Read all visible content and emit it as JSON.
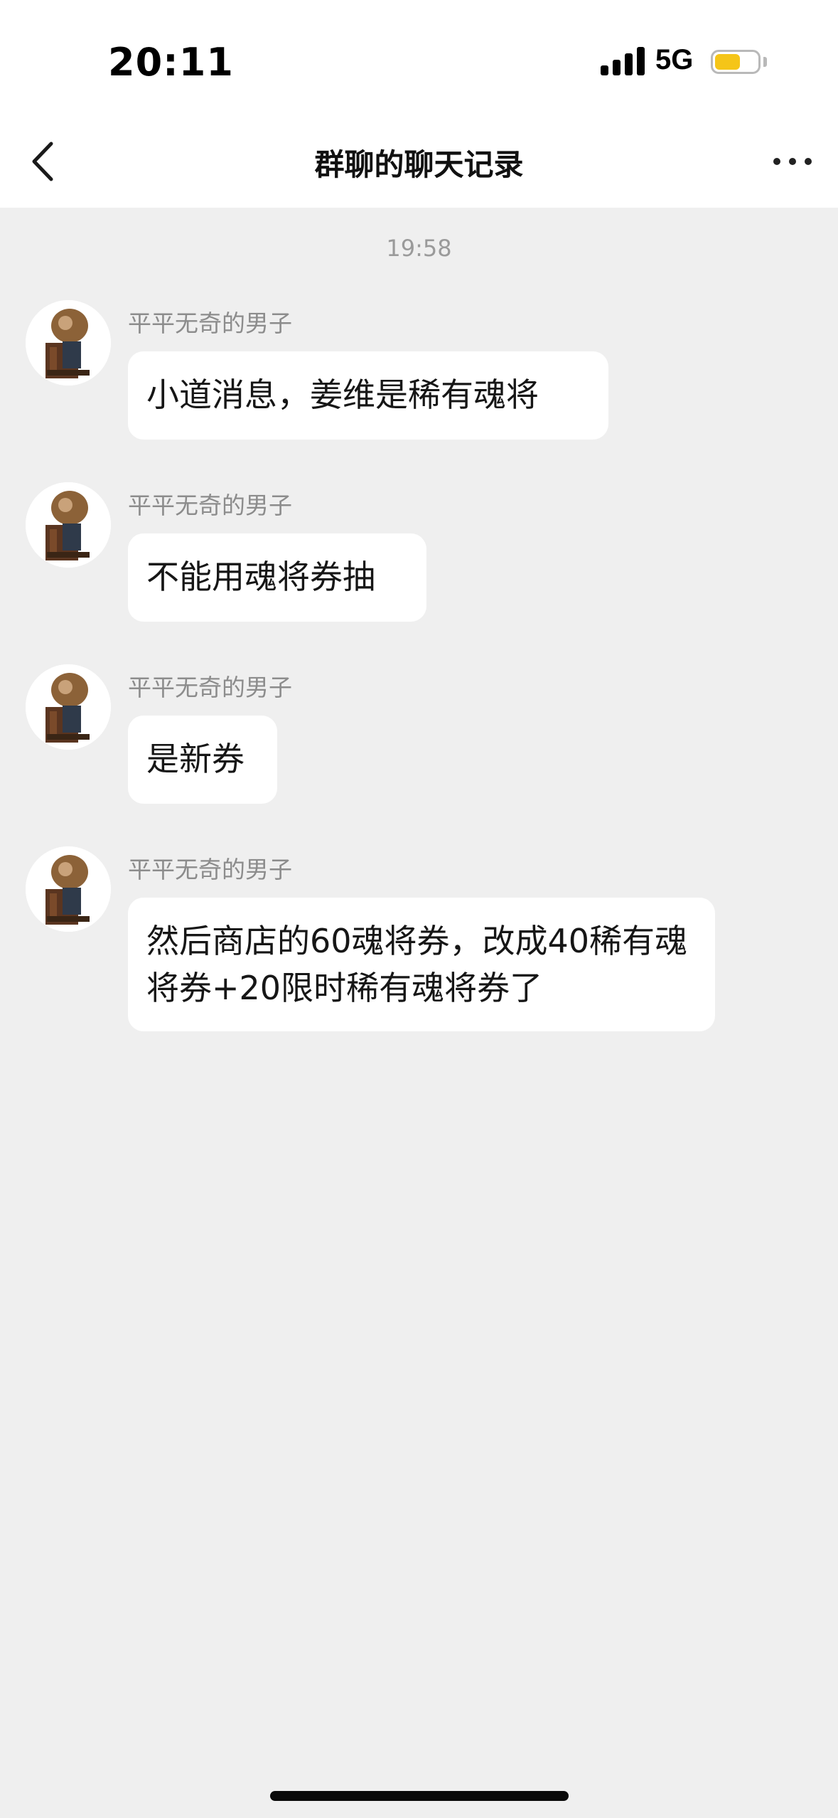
{
  "status_bar": {
    "time": "20:11",
    "network": "5G",
    "battery_color": "#f5c518",
    "battery_level": 0.6
  },
  "nav": {
    "title": "群聊的聊天记录",
    "back_icon": "chevron-left-icon",
    "more_icon": "ellipsis-icon"
  },
  "chat": {
    "timestamp": "19:58",
    "messages": [
      {
        "sender": "平平无奇的男子",
        "text": "小道消息，姜维是稀有魂将"
      },
      {
        "sender": "平平无奇的男子",
        "text": "不能用魂将券抽"
      },
      {
        "sender": "平平无奇的男子",
        "text": "是新券"
      },
      {
        "sender": "平平无奇的男子",
        "text": "然后商店的60魂将券，改成40稀有魂将券+20限时稀有魂将券了"
      }
    ]
  },
  "colors": {
    "background": "#efefef",
    "bubble": "#ffffff",
    "meta_text": "#8c8c8c"
  }
}
